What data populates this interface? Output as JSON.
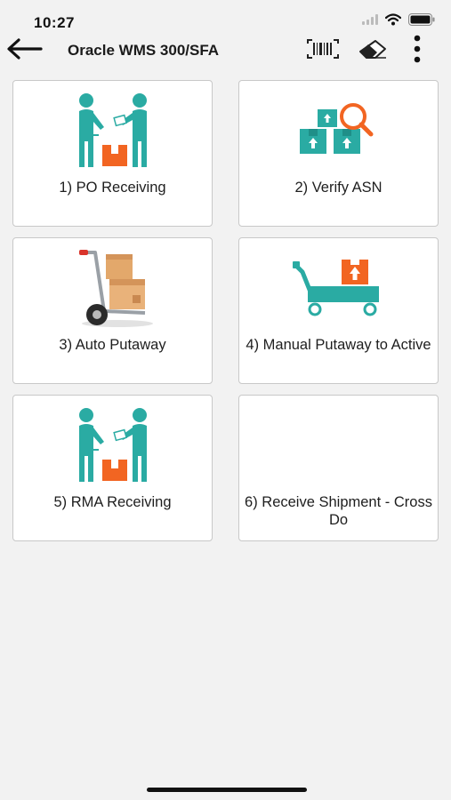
{
  "status_bar": {
    "time": "10:27"
  },
  "header": {
    "title": "Oracle WMS 300/SFA",
    "icons": [
      "back-arrow-icon",
      "barcode-scan-icon",
      "eraser-icon",
      "more-vertical-icon"
    ]
  },
  "tiles": [
    {
      "label": "1) PO Receiving",
      "icon": "receiving-people-icon"
    },
    {
      "label": "2) Verify ASN",
      "icon": "verify-boxes-icon"
    },
    {
      "label": "3) Auto Putaway",
      "icon": "hand-truck-icon"
    },
    {
      "label": "4) Manual Putaway to Active",
      "icon": "cart-box-icon"
    },
    {
      "label": "5) RMA Receiving",
      "icon": "receiving-people-icon"
    },
    {
      "label": "6) Receive Shipment - Cross Do",
      "icon": ""
    }
  ],
  "colors": {
    "teal": "#2aaba3",
    "orange": "#f26522",
    "background": "#f2f2f2"
  }
}
